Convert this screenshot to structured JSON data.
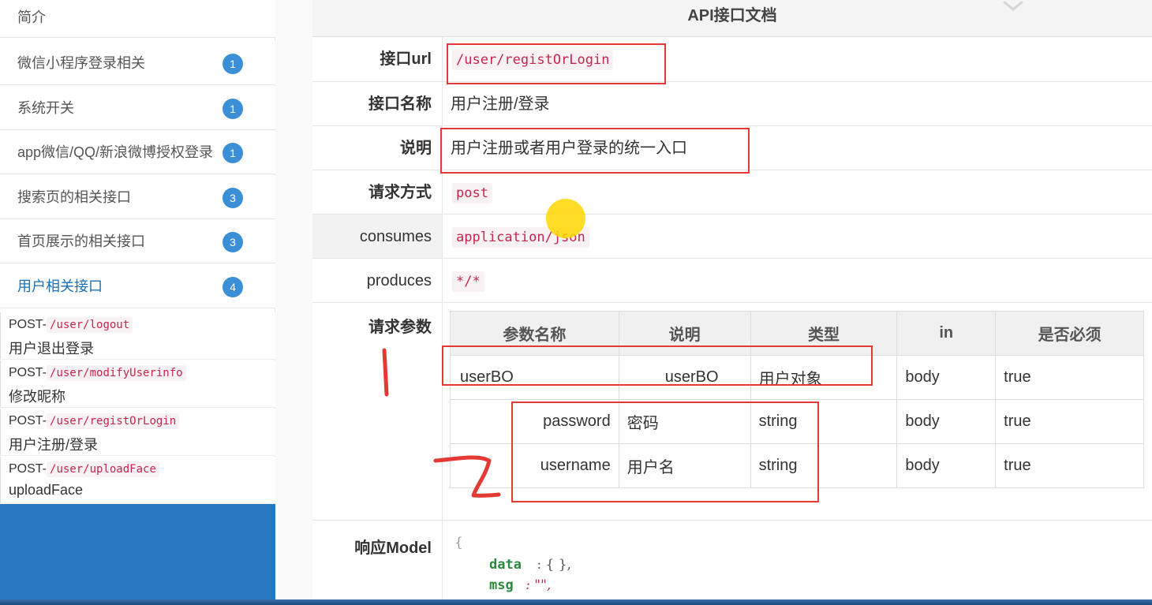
{
  "sidebar": {
    "menu": [
      {
        "label": "简介",
        "badge": ""
      },
      {
        "label": "微信小程序登录相关",
        "badge": "1"
      },
      {
        "label": "系统开关",
        "badge": "1"
      },
      {
        "label": "app微信/QQ/新浪微博授权登录",
        "badge": "1"
      },
      {
        "label": "搜索页的相关接口",
        "badge": "3"
      },
      {
        "label": "首页展示的相关接口",
        "badge": "3"
      },
      {
        "label": "用户相关接口",
        "badge": "4"
      }
    ],
    "apis": [
      {
        "method": "POST-",
        "path": "/user/logout",
        "desc": "用户退出登录"
      },
      {
        "method": "POST-",
        "path": "/user/modifyUserinfo",
        "desc": "修改昵称"
      },
      {
        "method": "POST-",
        "path": "/user/registOrLogin",
        "desc": "用户注册/登录"
      },
      {
        "method": "POST-",
        "path": "/user/uploadFace",
        "desc": "uploadFace"
      }
    ]
  },
  "doc": {
    "title": "API接口文档",
    "rows": {
      "url_key": "接口url",
      "url_val": "/user/registOrLogin",
      "name_key": "接口名称",
      "name_val": "用户注册/登录",
      "desc_key": "说明",
      "desc_val": "用户注册或者用户登录的统一入口",
      "method_key": "请求方式",
      "method_val": "post",
      "consumes_key": "consumes",
      "consumes_val": "application/json",
      "produces_key": "produces",
      "produces_val": "*/*",
      "params_key": "请求参数",
      "response_key": "响应Model"
    },
    "params_table": {
      "headers": [
        "参数名称",
        "说明",
        "类型",
        "in",
        "是否必须"
      ],
      "rows": [
        {
          "name": "userBO",
          "desc": "userBO",
          "type": "用户对象",
          "in": "body",
          "required": "true"
        },
        {
          "name": "password",
          "desc": "密码",
          "type": "string",
          "in": "body",
          "required": "true"
        },
        {
          "name": "username",
          "desc": "用户名",
          "type": "string",
          "in": "body",
          "required": "true"
        }
      ]
    },
    "response_model": {
      "open": "{",
      "data_key": "data",
      "data_val": ": { },",
      "msg_key": "msg",
      "msg_val": ": \"\","
    }
  },
  "annotations": {
    "mark1": "1",
    "mark2": "2"
  },
  "colors": {
    "accent": "#2878bd",
    "badge": "#3b8fd6",
    "code": "#c7254e",
    "annotation": "#e53935"
  }
}
